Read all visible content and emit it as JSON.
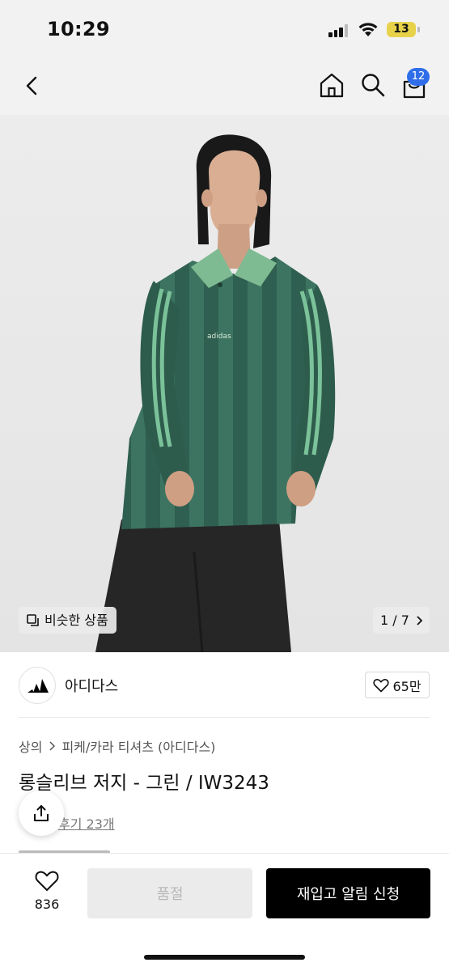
{
  "status_bar": {
    "time": "10:29",
    "battery": "13",
    "battery_color": "#e8d24a"
  },
  "nav": {
    "cart_count": "12",
    "badge_color": "#2f6ee8",
    "icons": [
      "back-icon",
      "home-icon",
      "search-icon",
      "shopping-bag-icon"
    ]
  },
  "hero": {
    "similar_label": "비슷한 상품",
    "page_counter": "1 / 7",
    "chest_logo": "adidas"
  },
  "brand": {
    "name": "아디다스",
    "likes": "65만"
  },
  "product": {
    "breadcrumb": [
      "상의",
      "피케/카라 티셔츠 (아디다스)"
    ],
    "title": "롱슬리브 저지 - 그린 / IW3243",
    "reviews_link": "후기 23개"
  },
  "bottom_bar": {
    "wish_count": "836",
    "soldout_label": "품절",
    "restock_label": "재입고 알림 신청"
  }
}
